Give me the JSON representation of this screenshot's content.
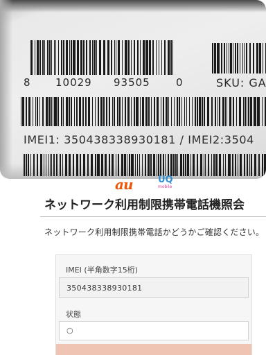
{
  "label_photo": {
    "barcode_digits": [
      "8",
      "10029",
      "93505",
      "0"
    ],
    "sku_text": "SKU: GA",
    "imei_line": "IMEI1: 350438338930181 / IMEI2:3504"
  },
  "header": {
    "carrier_logo_1": "au",
    "carrier_logo_2": "UQ",
    "carrier_logo_2_sub": "mobile",
    "title": "ネットワーク利用制限携帯電話機照会",
    "description": "ネットワーク利用制限携帯電話かどうかご確認ください。"
  },
  "form": {
    "imei_label": "IMEI (半角数字15桁)",
    "imei_value": "350438338930181",
    "status_label": "状態",
    "status_value": "○"
  },
  "colors": {
    "au_brand": "#eb5505",
    "uq_brand": "#2e8fd6",
    "submit_button": "#f0c4b2"
  }
}
